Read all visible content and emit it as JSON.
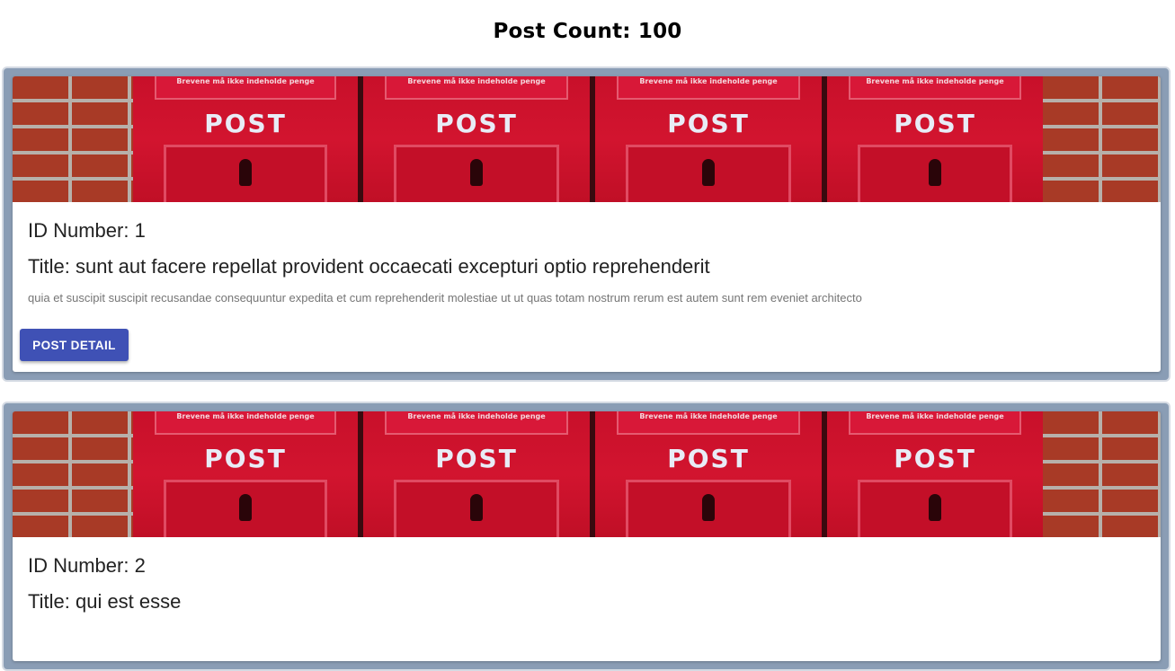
{
  "header": {
    "post_count_label": "Post Count: 100"
  },
  "posts": [
    {
      "id_label": "ID Number: 1",
      "title_label": "Title: sunt aut facere repellat provident occaecati excepturi optio reprehenderit",
      "body": "quia et suscipit suscipit recusandae consequuntur expedita et cum reprehenderit molestiae ut ut quas totam nostrum rerum est autem sunt rem eveniet architecto",
      "button_label": "POST DETAIL"
    },
    {
      "id_label": "ID Number: 2",
      "title_label": "Title: qui est esse"
    }
  ],
  "media": {
    "slot_text": "Brevene må ikke indeholde penge",
    "box_word": "POST"
  },
  "colors": {
    "card_frame": "#8a9db5",
    "button": "#3f51b5",
    "postbox_red": "#c8102a",
    "brick": "#a83a26"
  }
}
